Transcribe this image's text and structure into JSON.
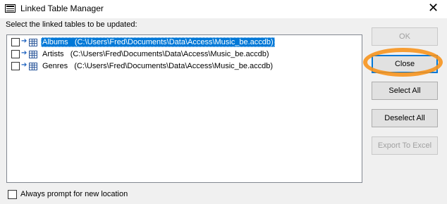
{
  "window": {
    "title": "Linked Table Manager",
    "close_glyph": "✕"
  },
  "prompt": "Select the linked tables to be updated:",
  "tables": [
    {
      "text": "Albums   (C:\\Users\\Fred\\Documents\\Data\\Access\\Music_be.accdb)",
      "checked": false,
      "selected": true
    },
    {
      "text": "Artists   (C:\\Users\\Fred\\Documents\\Data\\Access\\Music_be.accdb)",
      "checked": false,
      "selected": false
    },
    {
      "text": "Genres   (C:\\Users\\Fred\\Documents\\Data\\Access\\Music_be.accdb)",
      "checked": false,
      "selected": false
    }
  ],
  "buttons": {
    "ok": "OK",
    "close": "Close",
    "select_all": "Select All",
    "deselect_all": "Deselect All",
    "export_to_excel": "Export To Excel"
  },
  "always_prompt": {
    "label": "Always prompt for new location",
    "checked": false
  },
  "colors": {
    "selection": "#0078d7",
    "highlight_ring": "#f7941d"
  }
}
